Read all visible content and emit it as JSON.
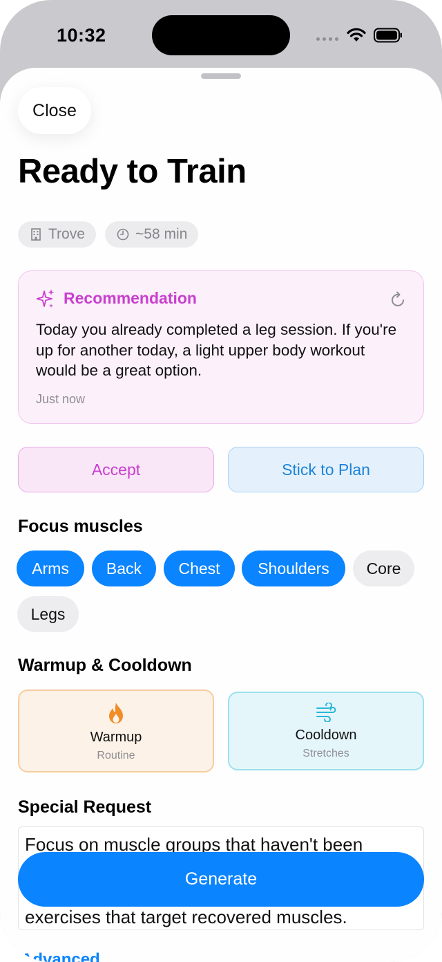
{
  "status_bar": {
    "time": "10:32"
  },
  "header": {
    "close_label": "Close",
    "title": "Ready to Train"
  },
  "meta_chips": [
    {
      "icon": "building-icon",
      "label": "Trove"
    },
    {
      "icon": "clock-icon",
      "label": "~58 min"
    }
  ],
  "recommendation": {
    "title": "Recommendation",
    "body": "Today you already completed a leg session. If you're up for another today, a light upper body workout would be a great option.",
    "timestamp": "Just now"
  },
  "actions": {
    "accept_label": "Accept",
    "stick_label": "Stick to Plan"
  },
  "focus": {
    "heading": "Focus muscles",
    "muscles": [
      {
        "label": "Arms",
        "selected": true
      },
      {
        "label": "Back",
        "selected": true
      },
      {
        "label": "Chest",
        "selected": true
      },
      {
        "label": "Shoulders",
        "selected": true
      },
      {
        "label": "Core",
        "selected": false
      },
      {
        "label": "Legs",
        "selected": false
      }
    ]
  },
  "warmup_cooldown": {
    "heading": "Warmup & Cooldown",
    "warmup": {
      "icon": "flame-icon",
      "label": "Warmup",
      "sublabel": "Routine"
    },
    "cooldown": {
      "icon": "wind-icon",
      "label": "Cooldown",
      "sublabel": "Stretches"
    }
  },
  "special_request": {
    "heading": "Special Request",
    "line1": "Focus on muscle groups that haven't been",
    "line3": "exercises that target recovered muscles."
  },
  "generate_label": "Generate",
  "advanced_label": "Advanced",
  "colors": {
    "accent_blue": "#0a84ff",
    "recommendation_purple": "#c93fcf",
    "warmup_orange": "#f6cc9e",
    "cooldown_cyan": "#9be0ef"
  }
}
